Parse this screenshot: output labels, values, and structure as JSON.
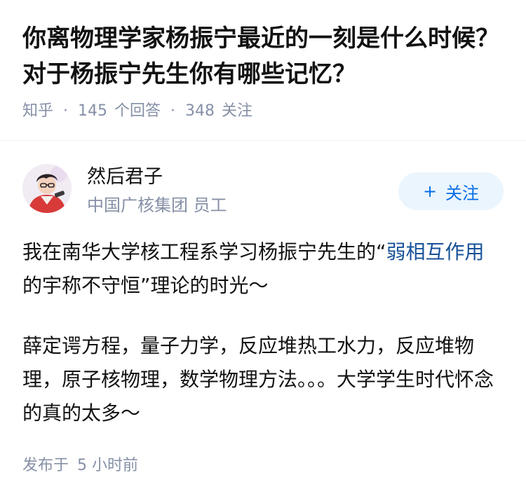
{
  "question": {
    "title": "你离物理学家杨振宁最近的一刻是什么时候？对于杨振宁先生你有哪些记忆？",
    "source": "知乎",
    "answers_count": "145",
    "answers_label": "个回答",
    "followers_count": "348",
    "followers_label": "关注"
  },
  "author": {
    "name": "然后君子",
    "description": "中国广核集团 员工",
    "avatar_icon": "user-avatar",
    "follow_label": "关注",
    "follow_icon": "plus-icon"
  },
  "answer": {
    "p1_before": "我在南华大学核工程系学习杨振宁先生的“",
    "p1_link": "弱相互作用",
    "p1_after": "的宇称不守恒”理论的时光～",
    "p2": "薛定谔方程，量子力学，反应堆热工水力，反应堆物理，原子核物理，数学物理方法。。。大学学生时代怀念的真的太多～",
    "published_label": "发布于",
    "published_time": "5 小时前"
  },
  "colors": {
    "text": "#121212",
    "meta": "#8590a6",
    "link": "#175199",
    "brand_blue": "#056de8",
    "follow_bg": "#ebf5fd"
  }
}
